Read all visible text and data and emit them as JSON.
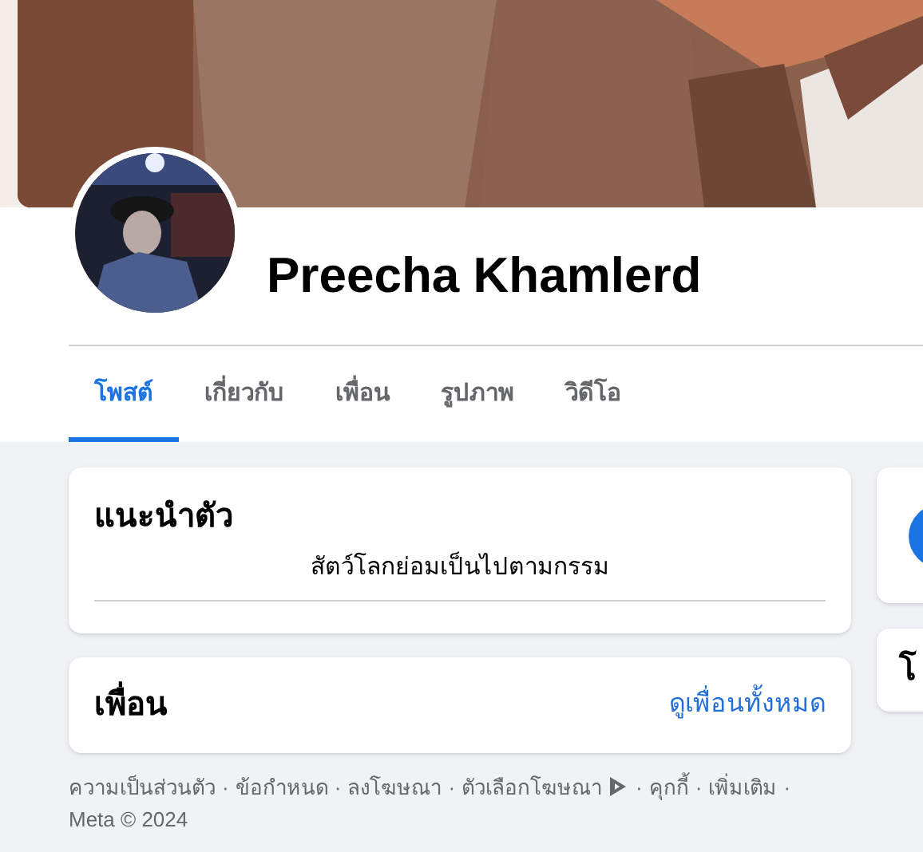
{
  "profile": {
    "name": "Preecha Khamlerd"
  },
  "tabs": [
    {
      "label": "โพสต์",
      "selected": true
    },
    {
      "label": "เกี่ยวกับ",
      "selected": false
    },
    {
      "label": "เพื่อน",
      "selected": false
    },
    {
      "label": "รูปภาพ",
      "selected": false
    },
    {
      "label": "วิดีโอ",
      "selected": false
    }
  ],
  "intro": {
    "title": "แนะนำตัว",
    "bio": "สัตว์โลกย่อมเป็นไปตามกรรม"
  },
  "friends": {
    "title": "เพื่อน",
    "link": "ดูเพื่อนทั้งหมด"
  },
  "side_card": {
    "title": "โ"
  },
  "footer_separator": "·",
  "footer": [
    {
      "label": "ความเป็นส่วนตัว",
      "kind": "link"
    },
    {
      "label": "ข้อกำหนด",
      "kind": "link"
    },
    {
      "label": "ลงโฆษณา",
      "kind": "link"
    },
    {
      "label": "ตัวเลือกโฆษณา",
      "kind": "ad_choices"
    },
    {
      "label": "คุกกี้",
      "kind": "link"
    },
    {
      "label": "เพิ่มเติม",
      "kind": "link"
    },
    {
      "label": "Meta © 2024",
      "kind": "copyright"
    }
  ]
}
